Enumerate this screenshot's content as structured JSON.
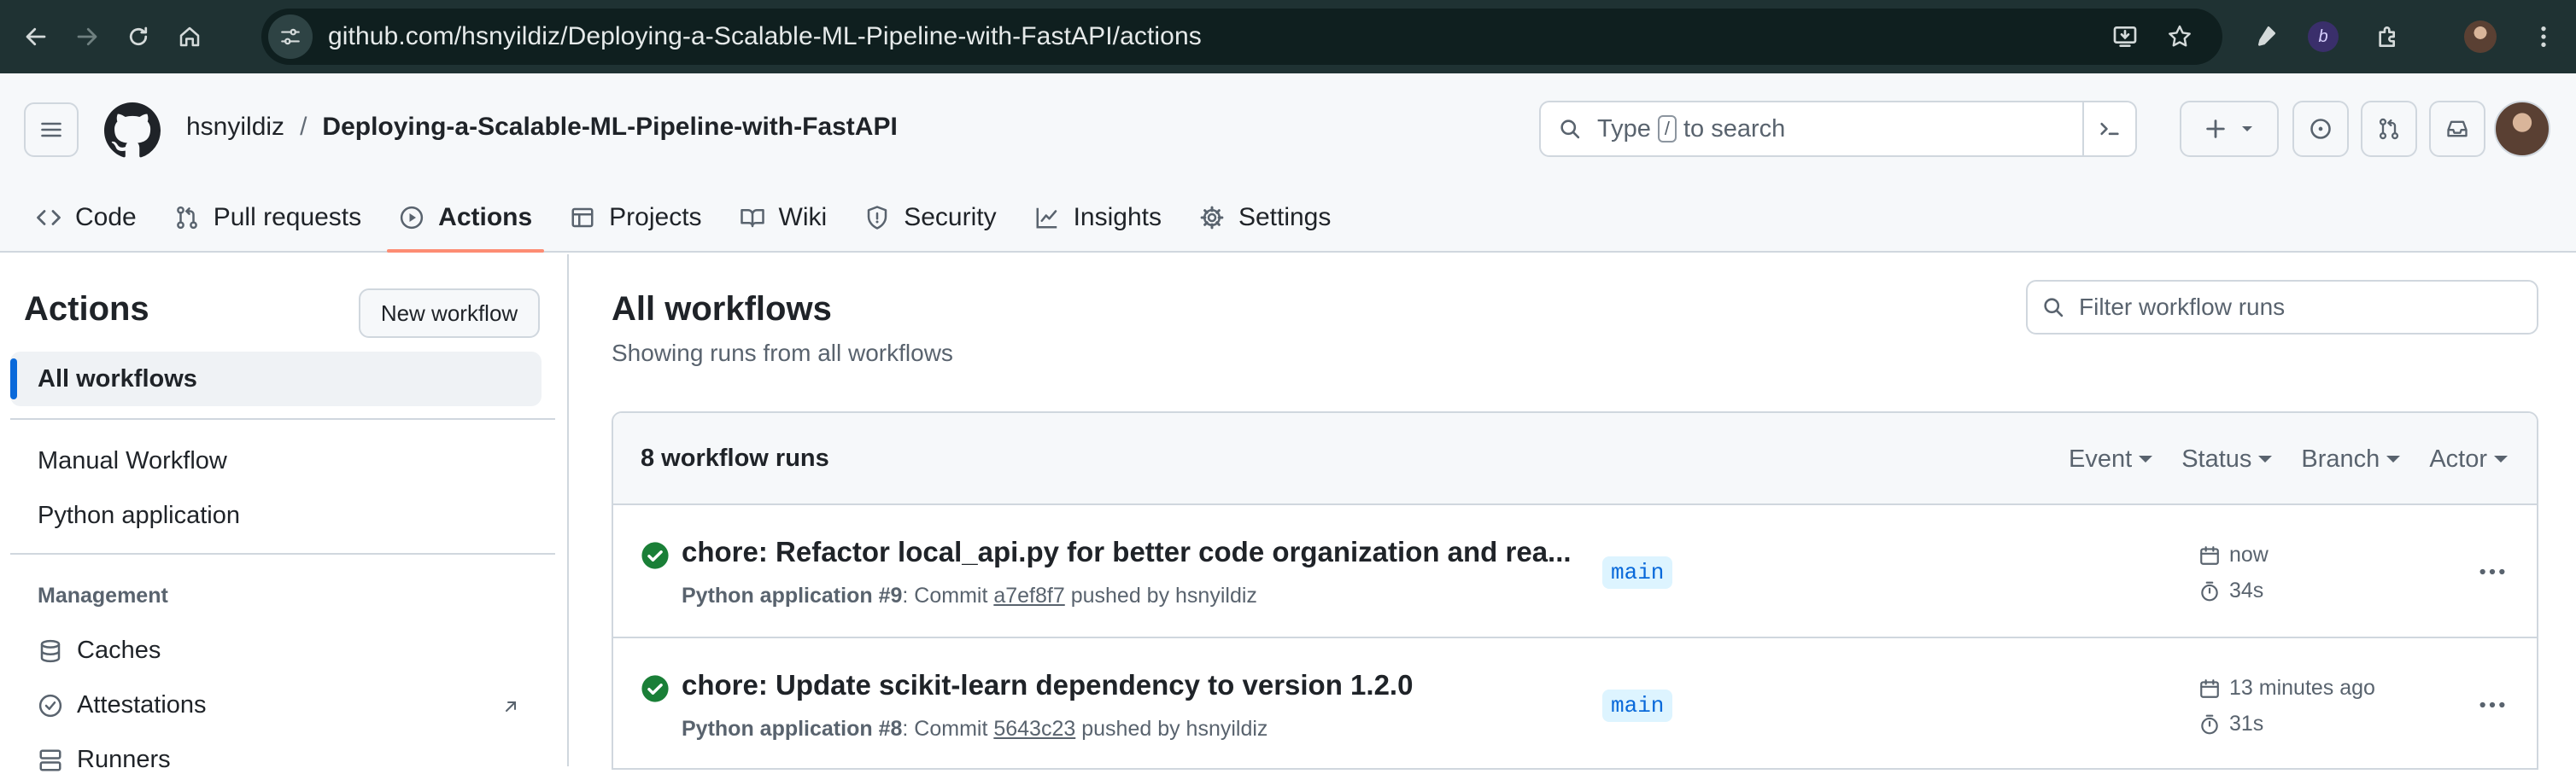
{
  "browser": {
    "url": "github.com/hsnyildiz/Deploying-a-Scalable-ML-Pipeline-with-FastAPI/actions"
  },
  "header": {
    "owner": "hsnyildiz",
    "separator": "/",
    "repo": "Deploying-a-Scalable-ML-Pipeline-with-FastAPI",
    "search_prefix": "Type",
    "search_key": "/",
    "search_suffix": "to search"
  },
  "repo_nav": {
    "tabs": [
      {
        "label": "Code",
        "icon": "code-icon"
      },
      {
        "label": "Pull requests",
        "icon": "git-pull-request-icon"
      },
      {
        "label": "Actions",
        "icon": "play-icon",
        "selected": true
      },
      {
        "label": "Projects",
        "icon": "table-icon"
      },
      {
        "label": "Wiki",
        "icon": "book-icon"
      },
      {
        "label": "Security",
        "icon": "shield-icon"
      },
      {
        "label": "Insights",
        "icon": "graph-icon"
      },
      {
        "label": "Settings",
        "icon": "gear-icon"
      }
    ]
  },
  "sidebar": {
    "title": "Actions",
    "new_workflow": "New workflow",
    "all_workflows": "All workflows",
    "workflows": [
      "Manual Workflow",
      "Python application"
    ],
    "management_heading": "Management",
    "management": [
      {
        "label": "Caches",
        "icon": "database-icon"
      },
      {
        "label": "Attestations",
        "icon": "verified-icon"
      },
      {
        "label": "Runners",
        "icon": "server-icon"
      }
    ]
  },
  "main": {
    "title": "All workflows",
    "subtitle": "Showing runs from all workflows",
    "filter_placeholder": "Filter workflow runs",
    "runs_count": "8 workflow runs",
    "filters": [
      "Event",
      "Status",
      "Branch",
      "Actor"
    ],
    "runs": [
      {
        "title": "chore: Refactor local_api.py for better code organization and rea...",
        "workflow": "Python application",
        "run_number": "#9",
        "commit_prefix": ": Commit",
        "sha": "a7ef8f7",
        "pushed_by": "pushed by hsnyildiz",
        "branch": "main",
        "when": "now",
        "duration": "34s",
        "status": "success"
      },
      {
        "title": "chore: Update scikit-learn dependency to version 1.2.0",
        "workflow": "Python application",
        "run_number": "#8",
        "commit_prefix": ": Commit",
        "sha": "5643c23",
        "pushed_by": "pushed by hsnyildiz",
        "branch": "main",
        "when": "13 minutes ago",
        "duration": "31s",
        "status": "success"
      }
    ]
  },
  "colors": {
    "accent": "#0969da",
    "success": "#1a7f37",
    "tab_underline": "#fd8c73"
  }
}
